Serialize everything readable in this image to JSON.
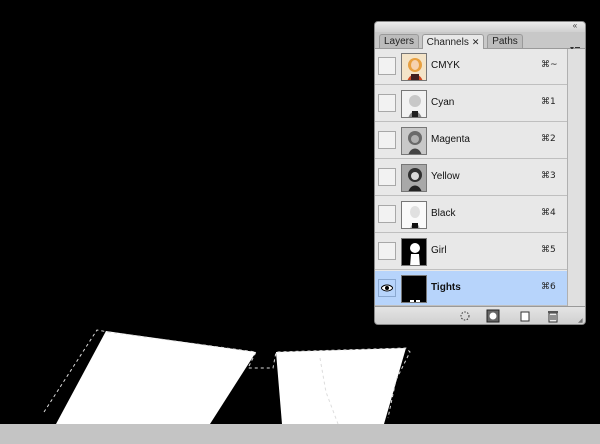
{
  "panel": {
    "tabs": [
      {
        "label": "Layers",
        "active": false
      },
      {
        "label": "Channels",
        "active": true,
        "closable": true
      },
      {
        "label": "Paths",
        "active": false
      }
    ],
    "close_glyph": "✕",
    "collapse_glyph": "«",
    "menu_icon": "panel-menu-icon",
    "channels": [
      {
        "name": "CMYK",
        "shortcut": "⌘~",
        "visible": false,
        "selected": false,
        "thumb": "color"
      },
      {
        "name": "Cyan",
        "shortcut": "⌘1",
        "visible": false,
        "selected": false,
        "thumb": "light"
      },
      {
        "name": "Magenta",
        "shortcut": "⌘2",
        "visible": false,
        "selected": false,
        "thumb": "mid"
      },
      {
        "name": "Yellow",
        "shortcut": "⌘3",
        "visible": false,
        "selected": false,
        "thumb": "dark"
      },
      {
        "name": "Black",
        "shortcut": "⌘4",
        "visible": false,
        "selected": false,
        "thumb": "light"
      },
      {
        "name": "Girl",
        "shortcut": "⌘5",
        "visible": false,
        "selected": false,
        "thumb": "mask-girl"
      },
      {
        "name": "Tights",
        "shortcut": "⌘6",
        "visible": true,
        "selected": true,
        "thumb": "mask-tights"
      }
    ],
    "tools": [
      "load-channel-as-selection-icon",
      "save-selection-as-channel-icon",
      "new-channel-icon",
      "delete-channel-icon"
    ]
  },
  "colors": {
    "canvas_bg": "#000000",
    "selection_fill": "#ffffff",
    "selected_row": "#b7d4fb",
    "status_strip": "#c4c4c4"
  }
}
